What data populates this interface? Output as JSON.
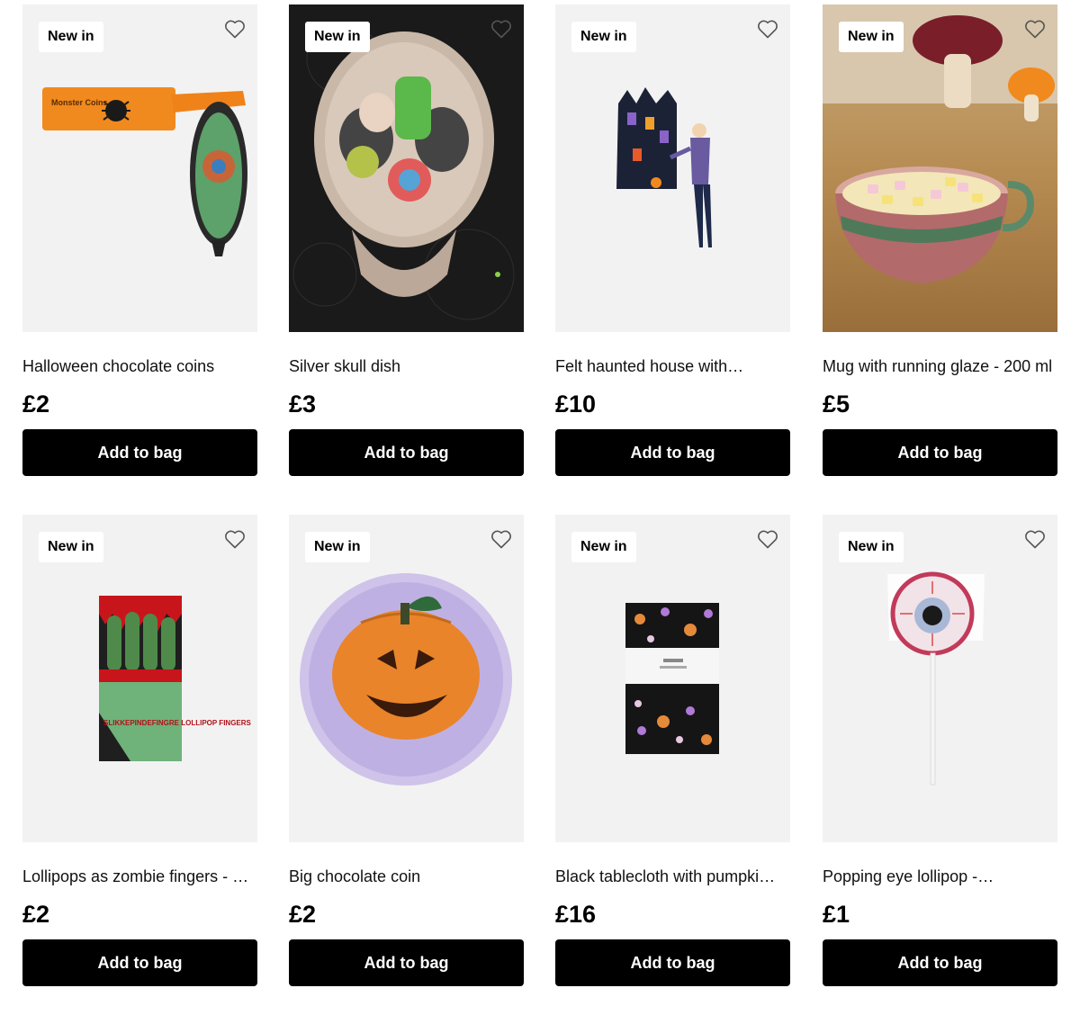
{
  "badge_label": "New in",
  "add_label": "Add to bag",
  "products": [
    {
      "title": "Halloween chocolate coins",
      "price": "£2",
      "image_text": "Monster Coins"
    },
    {
      "title": "Silver skull dish",
      "price": "£3"
    },
    {
      "title": "Felt haunted house with…",
      "price": "£10"
    },
    {
      "title": "Mug with running glaze - 200 ml",
      "price": "£5"
    },
    {
      "title": "Lollipops as zombie fingers - …",
      "price": "£2",
      "image_text": "SLIKKEPINDEFINGRE LOLLIPOP FINGERS"
    },
    {
      "title": "Big chocolate coin",
      "price": "£2"
    },
    {
      "title": "Black tablecloth with pumpki…",
      "price": "£16"
    },
    {
      "title": "Popping eye lollipop -…",
      "price": "£1"
    }
  ],
  "colors": {
    "button_bg": "#000000",
    "button_text": "#ffffff",
    "card_bg": "#f2f2f2"
  }
}
